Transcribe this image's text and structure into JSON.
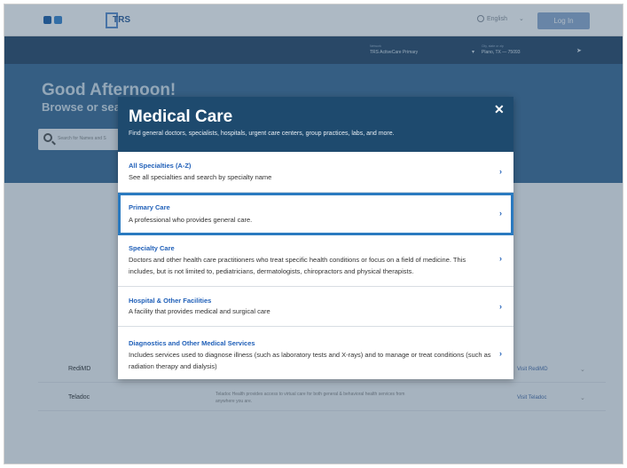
{
  "header": {
    "language": "English",
    "login_label": "Log In",
    "trs_logo_text": "TRS",
    "network_label": "Network",
    "network_value": "TRS ActiveCare Primary",
    "city_label": "City, state or zip",
    "city_value": "Plano, TX — 75093"
  },
  "hero": {
    "greeting": "Good Afternoon!",
    "browse": "Browse or sea",
    "search_placeholder": "Search for Names and S"
  },
  "background_rows": [
    {
      "name": "RediMD",
      "desc": "",
      "link": "Visit RediMD"
    },
    {
      "name": "Teladoc",
      "desc": "Teladoc Health provides access to virtual care for both general & behavioral health services from anywhere you are.",
      "link": "Visit Teladoc"
    }
  ],
  "modal": {
    "title": "Medical Care",
    "subtitle": "Find general doctors, specialists, hospitals, urgent care centers, group practices, labs, and more.",
    "close_glyph": "✕",
    "options": [
      {
        "title": "All Specialties (A-Z)",
        "desc": "See all specialties and search by specialty name"
      },
      {
        "title": "Primary Care",
        "desc": "A professional who provides general care."
      },
      {
        "title": "Specialty Care",
        "desc": "Doctors and other health care practitioners who treat specific health conditions or focus on a field of medicine. This includes, but is not limited to, pediatricians, dermatologists, chiropractors and physical therapists."
      },
      {
        "title": "Hospital & Other Facilities",
        "desc": "A facility that provides medical and surgical care"
      },
      {
        "title": "Diagnostics and Other Medical Services",
        "desc": "Includes services used to diagnose illness (such as laboratory tests and X-rays) and to manage or treat conditions (such as radiation therapy and dialysis)"
      }
    ],
    "chevron_glyph": "›"
  },
  "colors": {
    "modal_header": "#1e4a6e",
    "link_blue": "#1f5fb8",
    "focus_outline": "#2a7ac0"
  }
}
